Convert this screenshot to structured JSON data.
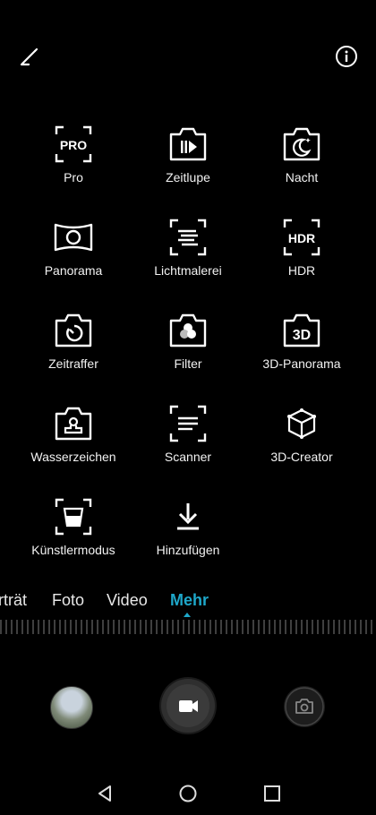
{
  "modes": [
    {
      "label": "Pro",
      "icon": "pro-icon"
    },
    {
      "label": "Zeitlupe",
      "icon": "slow-motion-icon"
    },
    {
      "label": "Nacht",
      "icon": "night-icon"
    },
    {
      "label": "Panorama",
      "icon": "panorama-icon"
    },
    {
      "label": "Lichtmalerei",
      "icon": "light-painting-icon"
    },
    {
      "label": "HDR",
      "icon": "hdr-icon"
    },
    {
      "label": "Zeitraffer",
      "icon": "time-lapse-icon"
    },
    {
      "label": "Filter",
      "icon": "filter-icon"
    },
    {
      "label": "3D-Panorama",
      "icon": "3d-panorama-icon"
    },
    {
      "label": "Wasserzeichen",
      "icon": "watermark-icon"
    },
    {
      "label": "Scanner",
      "icon": "scanner-icon"
    },
    {
      "label": "3D-Creator",
      "icon": "3d-creator-icon"
    },
    {
      "label": "Künstlermodus",
      "icon": "artist-mode-icon"
    },
    {
      "label": "Hinzufügen",
      "icon": "download-icon"
    }
  ],
  "tabs": {
    "portrait": "rträt",
    "foto": "Foto",
    "video": "Video",
    "mehr": "Mehr"
  },
  "colors": {
    "accent": "#1ea7c9",
    "background": "#000000"
  }
}
